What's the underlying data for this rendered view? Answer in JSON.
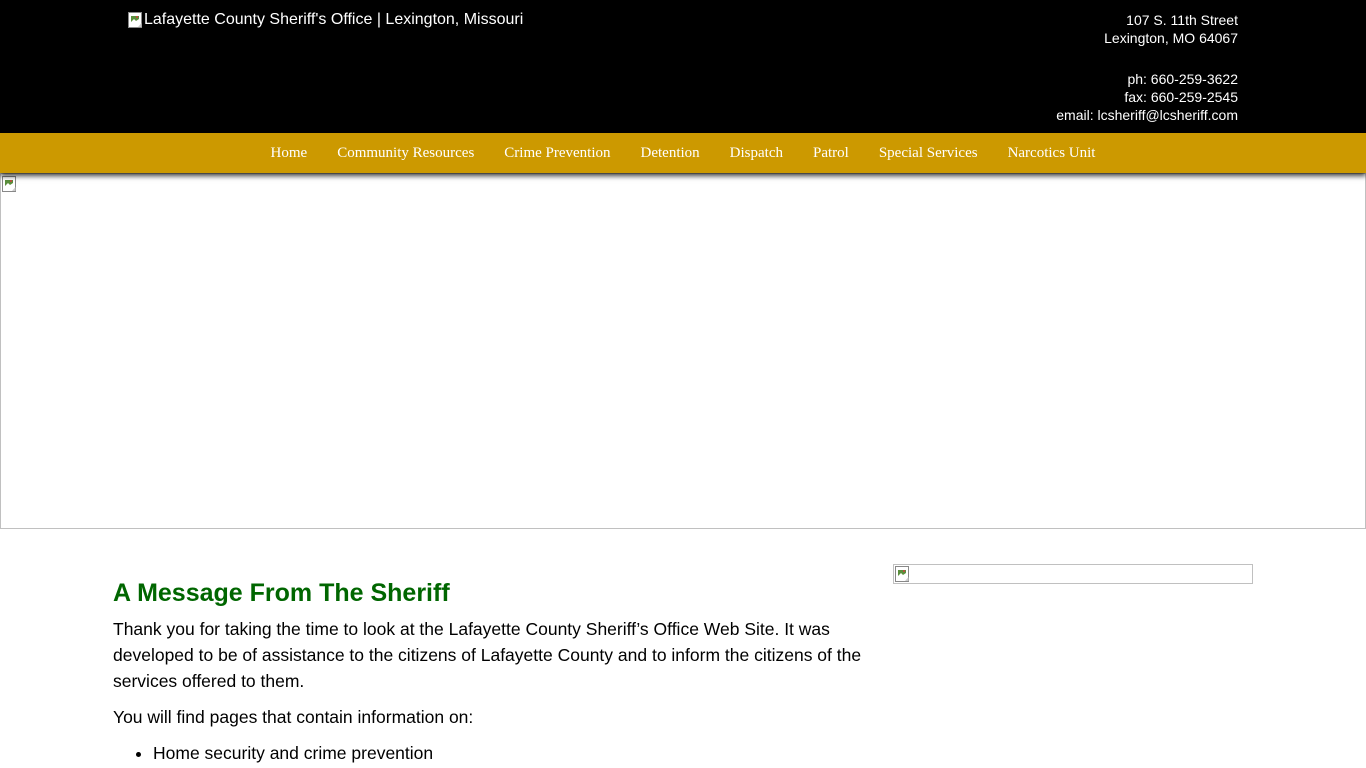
{
  "header": {
    "logo_alt": "Lafayette County Sheriff's Office | Lexington, Missouri",
    "address_line1": "107 S. 11th Street",
    "address_line2": "Lexington, MO 64067",
    "phone": "ph: 660-259-3622",
    "fax": "fax: 660-259-2545",
    "email": "email: lcsheriff@lcsheriff.com"
  },
  "nav": {
    "items": [
      {
        "label": "Home"
      },
      {
        "label": "Community Resources"
      },
      {
        "label": "Crime Prevention"
      },
      {
        "label": "Detention"
      },
      {
        "label": "Dispatch"
      },
      {
        "label": "Patrol"
      },
      {
        "label": "Special Services"
      },
      {
        "label": "Narcotics Unit"
      }
    ]
  },
  "main": {
    "heading": "A Message From The Sheriff",
    "paragraph1": "Thank you for taking the time to look at the Lafayette County Sheriff’s Office Web Site. It was developed to be of assistance to the citizens of Lafayette County and to inform the citizens of the services offered to them.",
    "paragraph2": "You will find pages that contain information on:",
    "list": [
      {
        "text": "Home security and crime prevention"
      }
    ]
  },
  "colors": {
    "header_bg": "#000000",
    "nav_bg": "#cc9900",
    "heading": "#006600"
  },
  "icons": {
    "broken_image": "broken-image-icon"
  }
}
